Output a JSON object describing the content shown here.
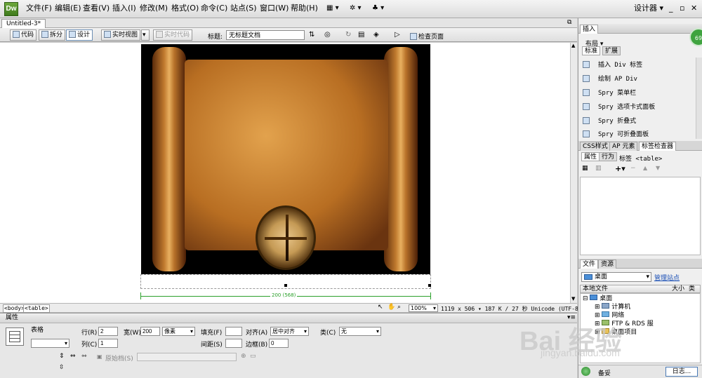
{
  "app": {
    "logo": "Dw"
  },
  "menu": {
    "items": [
      "文件(F)",
      "编辑(E)",
      "查看(V)",
      "插入(I)",
      "修改(M)",
      "格式(O)",
      "命令(C)",
      "站点(S)",
      "窗口(W)",
      "帮助(H)"
    ],
    "workspace": "设计器",
    "window_controls": [
      "_",
      "▫",
      "✕"
    ]
  },
  "document": {
    "tab": "Untitled-3*",
    "toolbar": {
      "code": "代码",
      "split": "拆分",
      "design": "设计",
      "live_view": "实时视图",
      "live_code": "实时代码",
      "title_label": "标题:",
      "title_value": "无标题文档",
      "check_page": "检查页面"
    },
    "table_width_label": "200 (568)"
  },
  "status": {
    "tags": [
      "<body>",
      "<table>"
    ],
    "zoom": "100%",
    "info": "1119 x 506 ▾ 187 K / 27 秒  Unicode (UTF-8)"
  },
  "properties": {
    "header": "属性",
    "table_label": "表格",
    "rows_label": "行(R)",
    "rows_value": "2",
    "cols_label": "列(C)",
    "cols_value": "1",
    "width_label": "宽(W)",
    "width_value": "200",
    "unit": "像素",
    "padding_label": "填充(F)",
    "padding_value": "",
    "spacing_label": "间距(S)",
    "spacing_value": "",
    "align_label": "对齐(A)",
    "align_value": "居中对齐",
    "border_label": "边框(B)",
    "border_value": "0",
    "class_label": "类(C)",
    "class_value": "无",
    "source_label": "原始档(S)"
  },
  "right_panel": {
    "insert_tab": "插入",
    "layout_label": "布局",
    "mode_tabs": [
      "标准",
      "扩展"
    ],
    "insert_items": [
      "插入 Div 标签",
      "绘制 AP Div",
      "Spry 菜单栏",
      "Spry 选项卡式面板",
      "Spry 折叠式",
      "Spry 可折叠面板"
    ],
    "css_tabs": [
      "CSS样式",
      "AP 元素",
      "标签检查器"
    ],
    "attr_tabs": [
      "属性",
      "行为"
    ],
    "tag_label": "标签 <table>",
    "files_tabs": [
      "文件",
      "资源"
    ],
    "site_select": "桌面",
    "manage_sites": "管理站点",
    "local_files": "本地文件",
    "size_col": "大小",
    "type_col": "类",
    "tree": [
      "桌面",
      "计算机",
      "网络",
      "FTP & RDS 服",
      "桌面项目"
    ],
    "ready": "备妥",
    "log_button": "日志..."
  },
  "watermark": {
    "main": "Bai 经验",
    "sub": "jingyan.baidu.com"
  },
  "colors": {
    "accent_green": "#2aa02a",
    "logo_green": "#4f8f2a",
    "panel_bg": "#efefef"
  }
}
